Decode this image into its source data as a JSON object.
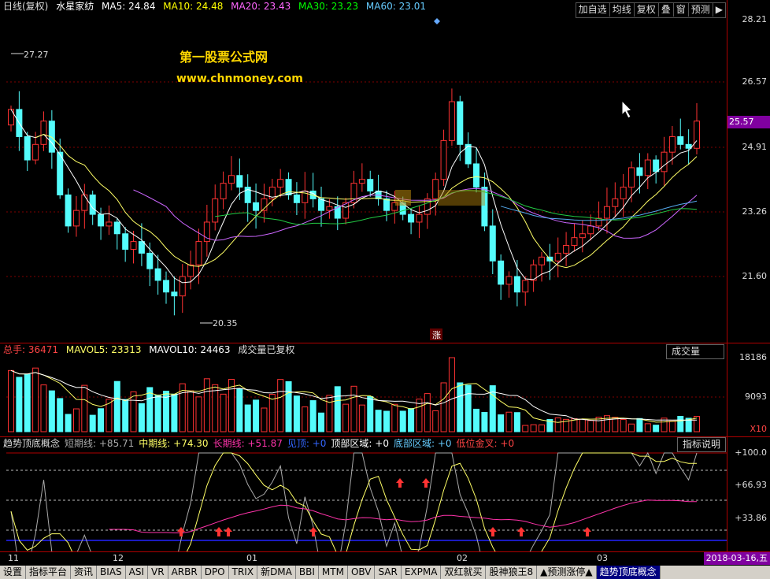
{
  "price_pane": {
    "period": "日线(复权)",
    "stock_name": "水星家纺",
    "ma": [
      {
        "label": "MA5: 24.84",
        "color": "#ffffff"
      },
      {
        "label": "MA10: 24.48",
        "color": "#ffff00"
      },
      {
        "label": "MA20: 23.43",
        "color": "#ff66ff"
      },
      {
        "label": "MA30: 23.23",
        "color": "#00ff00"
      },
      {
        "label": "MA60: 23.01",
        "color": "#66ccff"
      }
    ],
    "axis_labels": [
      "28.21",
      "26.57",
      "25.57",
      "24.91",
      "23.26",
      "21.60"
    ],
    "current_price": "25.57",
    "high_mark": "27.27",
    "low_mark": "20.35",
    "watermark_title": "第一股票公式网",
    "watermark_url": "www.chnmoney.com",
    "limit_up_badge": "涨"
  },
  "toolbar": {
    "items": [
      "加自选",
      "均线",
      "复权",
      "叠",
      "窗",
      "预测",
      "▶"
    ]
  },
  "volume_pane": {
    "total_label": "总手: 36471",
    "mavol5": "MAVOL5: 23313",
    "mavol10": "MAVOL10: 24463",
    "note": "成交量已复权",
    "selector": "成交量",
    "axis_labels": [
      "18186",
      "9093",
      "X10"
    ]
  },
  "indicator_pane": {
    "name": "趋势顶底概念",
    "items": [
      {
        "label": "短期线: +85.71",
        "color": "#aaaaaa"
      },
      {
        "label": "中期线: +74.30",
        "color": "#ffff66"
      },
      {
        "label": "长期线: +51.87",
        "color": "#ff33aa"
      },
      {
        "label": "见顶: +0",
        "color": "#3366ff"
      },
      {
        "label": "顶部区域: +0",
        "color": "#ffffff"
      },
      {
        "label": "底部区域: +0",
        "color": "#66ccff"
      },
      {
        "label": "低位金叉: +0",
        "color": "#ff4444"
      }
    ],
    "help_button": "指标说明",
    "axis_labels": [
      "+100.0",
      "+66.93",
      "+33.86"
    ]
  },
  "time_axis": {
    "labels": [
      "11",
      "12",
      "01",
      "02",
      "03"
    ],
    "current_date": "2018-03-16,五"
  },
  "bottom_tabs": [
    "设置",
    "指标平台",
    "资讯",
    "BIAS",
    "ASI",
    "VR",
    "ARBR",
    "DPO",
    "TRIX",
    "新DMA",
    "BBI",
    "MTM",
    "OBV",
    "SAR",
    "EXPMA",
    "双红就买",
    "股神狼王8",
    "▲预测涨停▲",
    "趋势顶底概念"
  ],
  "colors": {
    "up": "#ff3232",
    "down": "#54fcfc",
    "separator": "#b00000"
  }
}
